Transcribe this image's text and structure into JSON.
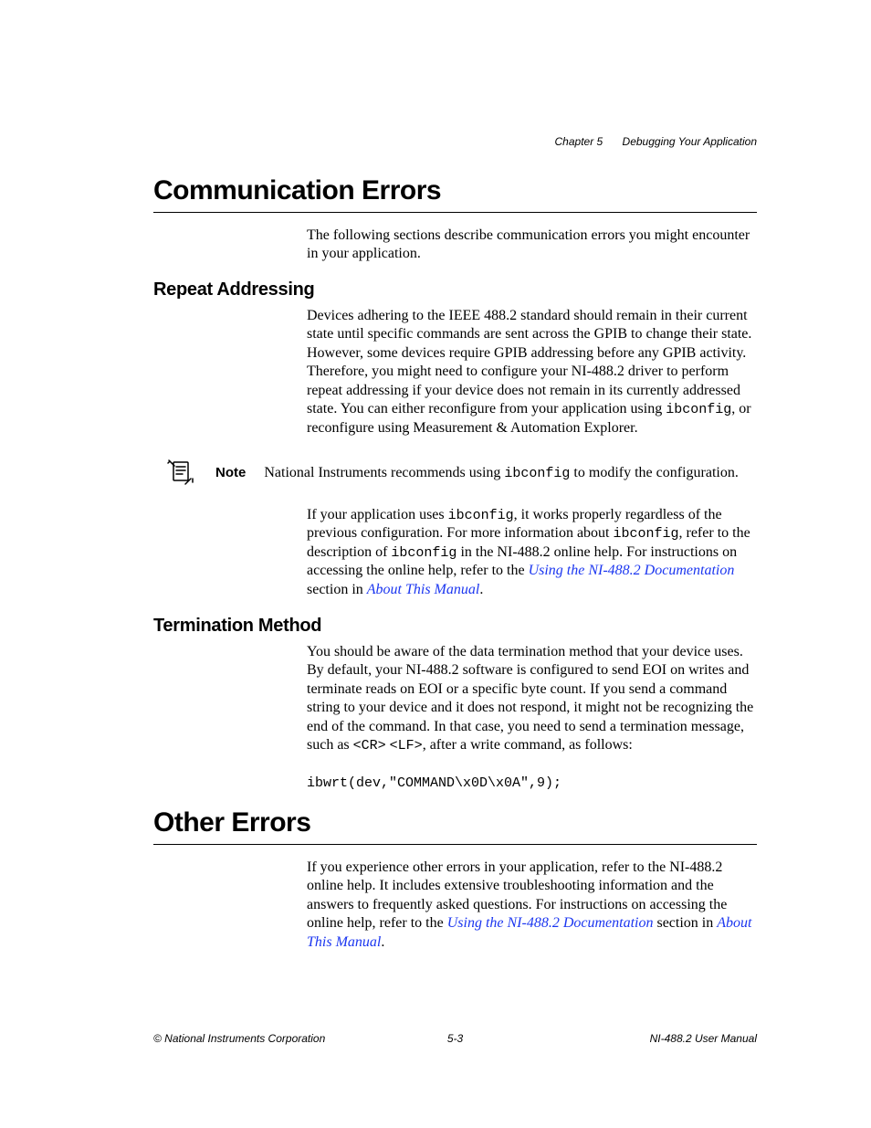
{
  "runningHead": {
    "chapter": "Chapter 5",
    "title": "Debugging Your Application"
  },
  "section1": {
    "heading": "Communication Errors",
    "intro": "The following sections describe communication errors you might encounter in your application."
  },
  "sub1": {
    "heading": "Repeat Addressing",
    "para1_pre": "Devices adhering to the IEEE 488.2 standard should remain in their current state until specific commands are sent across the GPIB to change their state. However, some devices require GPIB addressing before any GPIB activity. Therefore, you might need to configure your NI-488.2 driver to perform repeat addressing if your device does not remain in its currently addressed state. You can either reconfigure from your application using ",
    "para1_code": "ibconfig",
    "para1_post": ", or reconfigure using Measurement & Automation Explorer.",
    "note_label": "Note",
    "note_pre": "National Instruments recommends using ",
    "note_code": "ibconfig",
    "note_post": " to modify the configuration.",
    "para2_a": "If your application uses ",
    "para2_code1": "ibconfig",
    "para2_b": ", it works properly regardless of the previous configuration. For more information about ",
    "para2_code2": "ibconfig",
    "para2_c": ", refer to the description of ",
    "para2_code3": "ibconfig",
    "para2_d": " in the NI-488.2 online help. For instructions on accessing the online help, refer to the ",
    "para2_link1": "Using the NI-488.2 Documentation",
    "para2_e": " section in ",
    "para2_link2": "About This Manual",
    "para2_f": "."
  },
  "sub2": {
    "heading": "Termination Method",
    "para1_a": "You should be aware of the data termination method that your device uses. By default, your NI-488.2 software is configured to send EOI on writes and terminate reads on EOI or a specific byte count. If you send a command string to your device and it does not respond, it might not be recognizing the end of the command. In that case, you need to send a termination message, such as ",
    "para1_code1": "<CR>",
    "para1_b": " ",
    "para1_code2": "<LF>",
    "para1_c": ", after a write command, as follows:",
    "codeLine": "ibwrt(dev,\"COMMAND\\x0D\\x0A\",9);"
  },
  "section2": {
    "heading": "Other Errors",
    "para_a": "If you experience other errors in your application, refer to the NI-488.2 online help. It includes extensive troubleshooting information and the answers to frequently asked questions. For instructions on accessing the online help, refer to the ",
    "para_link1": "Using the NI-488.2 Documentation",
    "para_b": " section in ",
    "para_link2": "About This Manual",
    "para_c": "."
  },
  "footer": {
    "left": "© National Instruments Corporation",
    "center": "5-3",
    "right": "NI-488.2 User Manual"
  }
}
